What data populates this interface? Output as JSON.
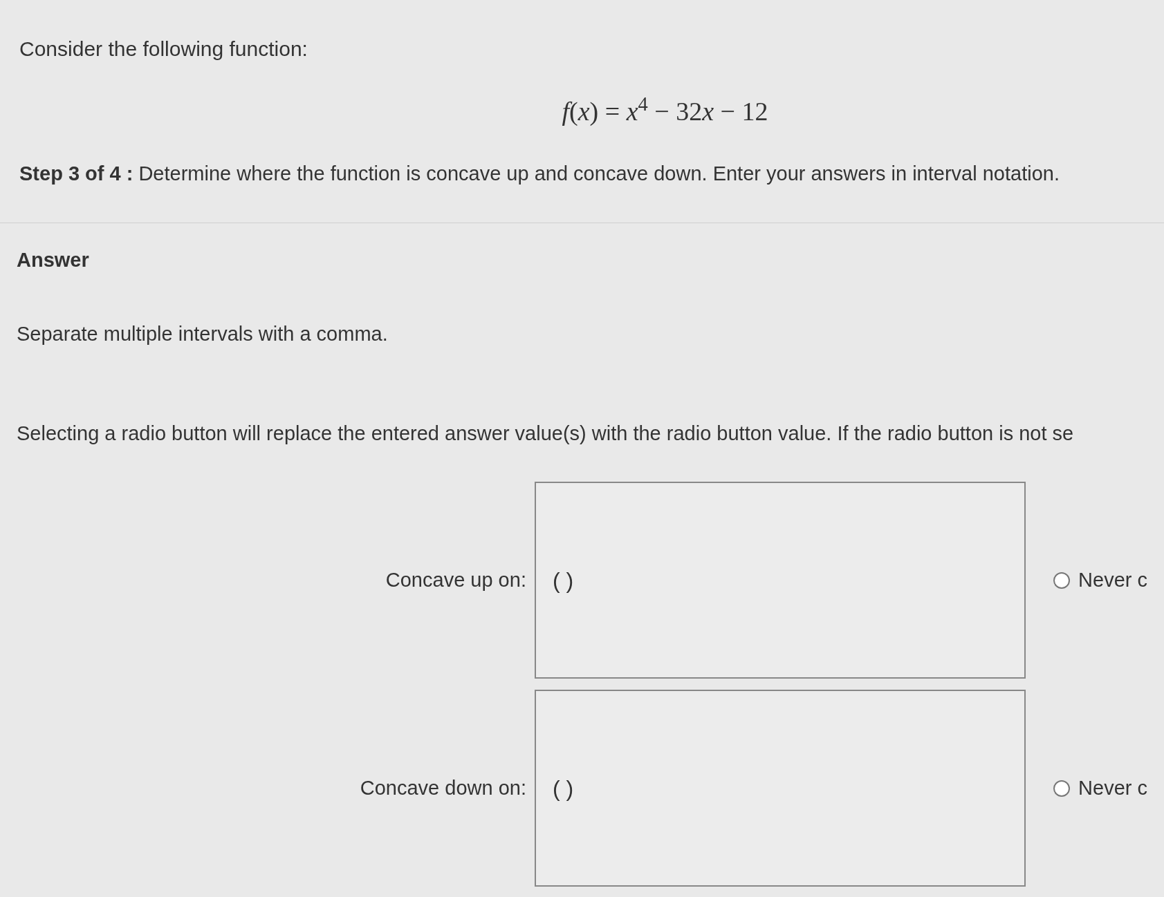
{
  "intro": "Consider the following function:",
  "formula": [
    "*f*(*x*) = *x*$^{4}$ − 32",
    "*x* − 12"
  ],
  "step": {
    "label": "Step 3 of 4 :",
    "text": "Determine where the function is concave up and concave down. Enter your answers in interval notation."
  },
  "answer_heading": "Answer",
  "hint": "Separate multiple intervals with a comma.",
  "radio_note": "Selecting a radio button will replace the entered answer value(s) with the radio button value. If the radio button is not se",
  "answers": [
    {
      "label": "Concave up on:",
      "value": "( )",
      "radio": {
        "label": "Never c",
        "selected": false
      }
    },
    {
      "label": "Concave down on:",
      "value": "( )",
      "radio": {
        "label": "Never c",
        "selected": false
      }
    }
  ]
}
